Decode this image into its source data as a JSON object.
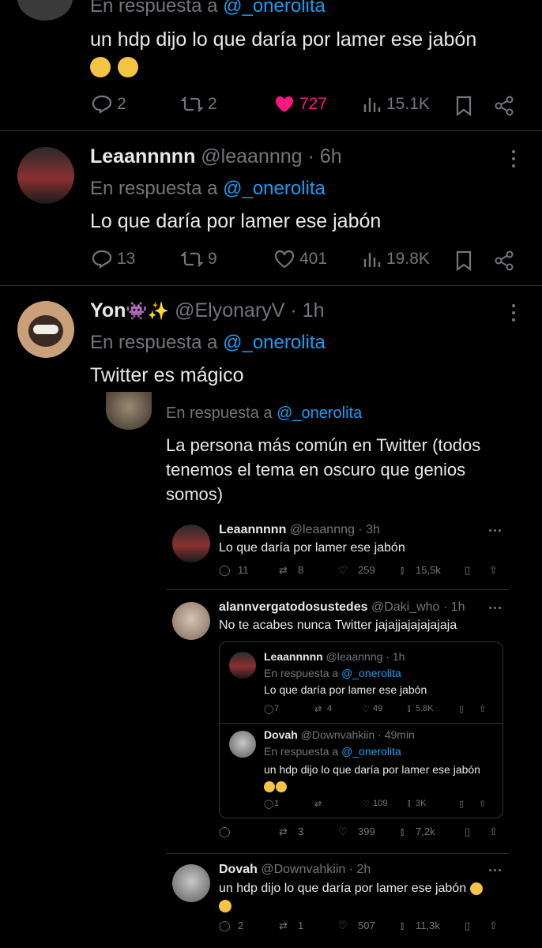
{
  "tweet1": {
    "reply_prefix": "En respuesta a",
    "reply_handle": "@_onerolita",
    "text": "un hdp dijo lo que daría por lamer ese jabón",
    "replies": "2",
    "retweets": "2",
    "likes": "727",
    "views": "15.1K"
  },
  "tweet2": {
    "name": "Leaannnnn",
    "handle": "@leaannng",
    "time": "· 6h",
    "reply_prefix": "En respuesta a",
    "reply_handle": "@_onerolita",
    "text": "Lo que daría por lamer ese jabón",
    "replies": "13",
    "retweets": "9",
    "likes": "401",
    "views": "19.8K"
  },
  "tweet3": {
    "name": "Yon",
    "name_emoji": "👾✨",
    "handle": "@ElyonaryV",
    "time": "· 1h",
    "reply_prefix": "En respuesta a",
    "reply_handle": "@_onerolita",
    "text": "Twitter es mágico"
  },
  "screenshot": {
    "reply_prefix": "En respuesta a",
    "reply_handle": "@_onerolita",
    "text": "La persona más común en Twitter (todos tenemos el tema en oscuro que genios somos)",
    "item1": {
      "name": "Leaannnnn",
      "handle": "@leaannng · 3h",
      "text": "Lo que daría por lamer ese jabón",
      "replies": "11",
      "retweets": "8",
      "likes": "259",
      "views": "15,5k"
    },
    "item2": {
      "name": "alannvergatodosustedes",
      "handle": "@Daki_who · 1h",
      "text": "No te acabes nunca Twitter jajajjajajajajaja",
      "replies": "",
      "retweets": "3",
      "likes": "399",
      "views": "7,2k",
      "nested1": {
        "name": "Leaannnnn",
        "handle": "@leaannng · 1h",
        "reply_prefix": "En respuesta a",
        "reply_handle": "@_onerolita",
        "text": "Lo que daría por lamer ese jabón",
        "replies": "7",
        "retweets": "4",
        "likes": "49",
        "views": "5.8K"
      },
      "nested2": {
        "name": "Dovah",
        "handle": "@Downvahkiin · 49min",
        "reply_prefix": "En respuesta a",
        "reply_handle": "@_onerolita",
        "text": "un hdp dijo lo que daría por lamer ese jabón",
        "replies": "1",
        "retweets": "",
        "likes": "109",
        "views": "3K"
      }
    },
    "item3": {
      "name": "Dovah",
      "handle": "@Downvahkiin · 2h",
      "text": "un hdp dijo lo que daría por lamer ese jabón",
      "replies": "2",
      "retweets": "1",
      "likes": "507",
      "views": "11,3k"
    }
  },
  "colors": {
    "background": "#000000",
    "link": "#1d9bf0",
    "like_active": "#f91880",
    "muted": "#71767b"
  }
}
